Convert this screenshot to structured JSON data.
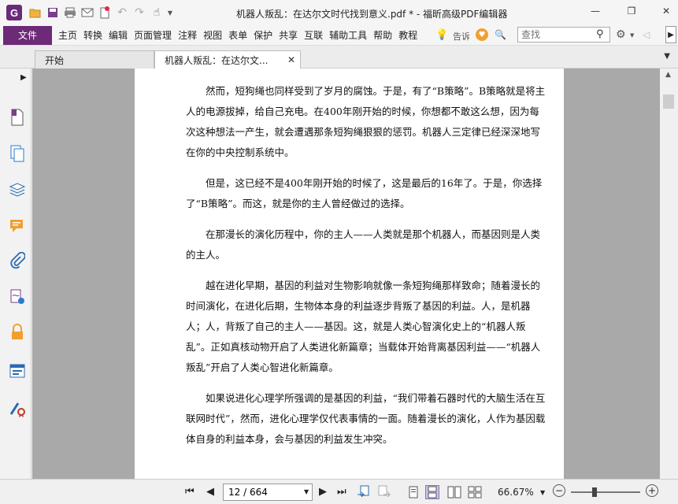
{
  "window": {
    "title": "机器人叛乱：在达尔文时代找到意义.pdf * - 福昕高级PDF编辑器",
    "app_logo_letter": "G",
    "minimize_glyph": "—",
    "restore_glyph": "❐",
    "close_glyph": "✕"
  },
  "ribbon": {
    "file_label": "文件",
    "tabs": [
      "主页",
      "转换",
      "编辑",
      "页面管理",
      "注释",
      "视图",
      "表单",
      "保护",
      "共享",
      "互联",
      "辅助工具",
      "帮助",
      "教程"
    ],
    "tell_me_label": "告诉",
    "search_placeholder": "查找"
  },
  "doc_tabs": [
    {
      "label": "开始"
    },
    {
      "label": "机器人叛乱：在达尔文..."
    }
  ],
  "document": {
    "paragraphs": [
      "然而，短狗绳也同样受到了岁月的腐蚀。于是，有了“B策略”。B策略就是将主人的电源拔掉，给自己充电。在400年刚开始的时候，你想都不敢这么想，因为每次这种想法一产生，就会遭遇那条短狗绳狠狠的惩罚。机器人三定律已经深深地写在你的中央控制系统中。",
      "但是，这已经不是400年刚开始的时候了，这是最后的16年了。于是，你选择了“B策略”。而这，就是你的主人曾经做过的选择。",
      "在那漫长的演化历程中，你的主人——人类就是那个机器人，而基因则是人类的主人。",
      "越在进化早期，基因的利益对生物影响就像一条短狗绳那样致命；随着漫长的时间演化，在进化后期，生物体本身的利益逐步背叛了基因的利益。人，是机器人；人，背叛了自己的主人——基因。这，就是人类心智演化史上的“机器人叛乱”。正如真核动物开启了人类进化新篇章；当载体开始背离基因利益——“机器人叛乱”开启了人类心智进化新篇章。",
      "如果说进化心理学所强调的是基因的利益，“我们带着石器时代的大脑生活在互联网时代”，然而，进化心理学仅代表事情的一面。随着漫长的演化，人作为基因载体自身的利益本身，会与基因的利益发生冲突。"
    ]
  },
  "status": {
    "page_display": "12 / 664",
    "zoom": "66.67%"
  },
  "colors": {
    "accent": "#6d2a77",
    "viewport_bg": "#a9a9a9"
  }
}
